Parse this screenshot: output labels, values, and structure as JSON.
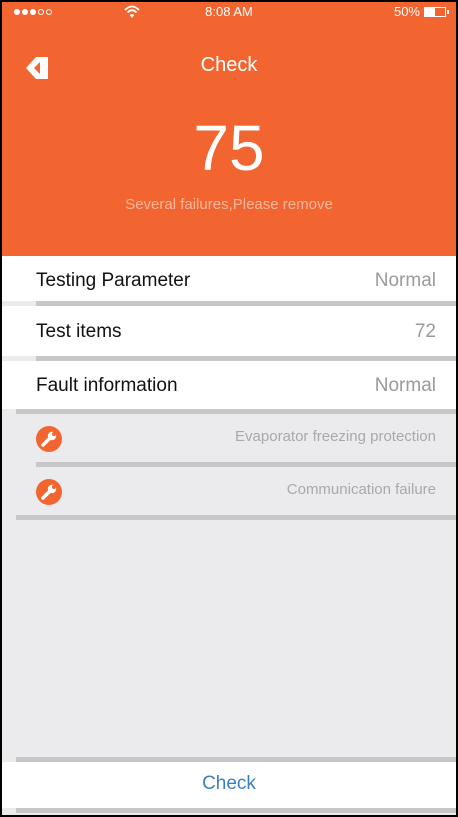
{
  "status_bar": {
    "time": "8:08 AM",
    "battery": "50%"
  },
  "nav": {
    "title": "Check"
  },
  "summary": {
    "score": "75",
    "message": "Several failures,Please remove"
  },
  "rows": [
    {
      "label": "Testing Parameter",
      "value": "Normal"
    },
    {
      "label": "Test items",
      "value": "72"
    },
    {
      "label": "Fault information",
      "value": "Normal"
    }
  ],
  "faults": [
    {
      "text": "Evaporator freezing protection",
      "icon": "wrench-icon"
    },
    {
      "text": "Communication failure",
      "icon": "wrench-icon"
    }
  ],
  "footer": {
    "button_label": "Check"
  },
  "colors": {
    "accent": "#f26531",
    "link": "#3a7fc1",
    "background": "#ebebee"
  }
}
